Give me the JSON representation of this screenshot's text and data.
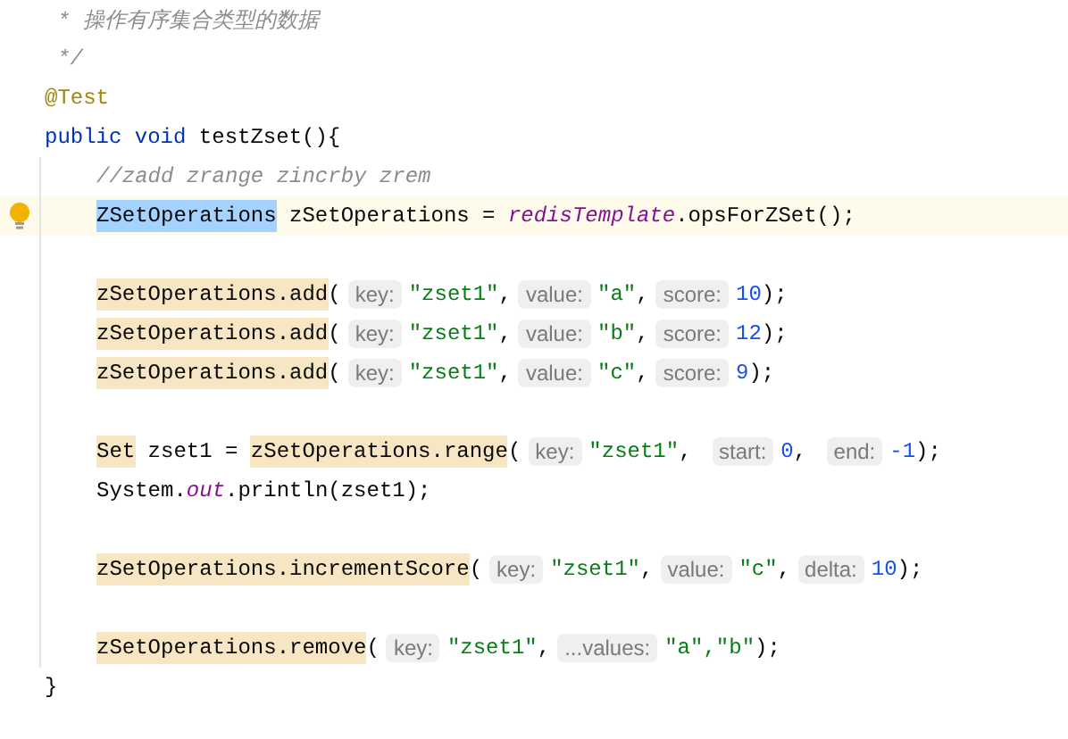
{
  "editor": {
    "lines": [
      {
        "kind": "doc",
        "tokens": [
          {
            "kind": "comment",
            "text": "* 操作有序集合类型的数据"
          }
        ]
      },
      {
        "kind": "doc",
        "tokens": [
          {
            "kind": "comment",
            "text": "*/"
          }
        ]
      },
      {
        "kind": "outer",
        "tokens": [
          {
            "kind": "annotation",
            "text": "@Test"
          }
        ]
      },
      {
        "kind": "outer",
        "tokens": [
          {
            "kind": "keyword",
            "text": "public void"
          },
          {
            "kind": "text",
            "text": " testZset(){"
          }
        ]
      },
      {
        "kind": "body",
        "tokens": [
          {
            "kind": "comment",
            "text": "//zadd zrange zincrby zrem"
          }
        ]
      },
      {
        "kind": "current",
        "tokens": [
          {
            "kind": "selection",
            "text": "ZSetOperations"
          },
          {
            "kind": "text",
            "text": " zSetOperations = "
          },
          {
            "kind": "field",
            "text": "redisTemplate"
          },
          {
            "kind": "text",
            "text": ".opsForZSet();"
          }
        ]
      },
      {
        "kind": "blank"
      },
      {
        "kind": "body",
        "tokens": [
          {
            "kind": "usage",
            "text": "zSetOperations.add"
          },
          {
            "kind": "text",
            "text": "("
          },
          {
            "kind": "hint",
            "text": "key:"
          },
          {
            "kind": "string",
            "text": "\"zset1\""
          },
          {
            "kind": "text",
            "text": ","
          },
          {
            "kind": "hint",
            "text": "value:"
          },
          {
            "kind": "string",
            "text": "\"a\""
          },
          {
            "kind": "text",
            "text": ","
          },
          {
            "kind": "hint",
            "text": "score:"
          },
          {
            "kind": "number",
            "text": "10"
          },
          {
            "kind": "text",
            "text": ");"
          }
        ]
      },
      {
        "kind": "body",
        "tokens": [
          {
            "kind": "usage",
            "text": "zSetOperations.add"
          },
          {
            "kind": "text",
            "text": "("
          },
          {
            "kind": "hint",
            "text": "key:"
          },
          {
            "kind": "string",
            "text": "\"zset1\""
          },
          {
            "kind": "text",
            "text": ","
          },
          {
            "kind": "hint",
            "text": "value:"
          },
          {
            "kind": "string",
            "text": "\"b\""
          },
          {
            "kind": "text",
            "text": ","
          },
          {
            "kind": "hint",
            "text": "score:"
          },
          {
            "kind": "number",
            "text": "12"
          },
          {
            "kind": "text",
            "text": ");"
          }
        ]
      },
      {
        "kind": "body",
        "tokens": [
          {
            "kind": "usage",
            "text": "zSetOperations.add"
          },
          {
            "kind": "text",
            "text": "("
          },
          {
            "kind": "hint",
            "text": "key:"
          },
          {
            "kind": "string",
            "text": "\"zset1\""
          },
          {
            "kind": "text",
            "text": ","
          },
          {
            "kind": "hint",
            "text": "value:"
          },
          {
            "kind": "string",
            "text": "\"c\""
          },
          {
            "kind": "text",
            "text": ","
          },
          {
            "kind": "hint",
            "text": "score:"
          },
          {
            "kind": "number",
            "text": "9"
          },
          {
            "kind": "text",
            "text": ");"
          }
        ]
      },
      {
        "kind": "blank"
      },
      {
        "kind": "body",
        "tokens": [
          {
            "kind": "usage",
            "text": "Set"
          },
          {
            "kind": "text",
            "text": " zset1 = "
          },
          {
            "kind": "usage",
            "text": "zSetOperations.range"
          },
          {
            "kind": "text",
            "text": "("
          },
          {
            "kind": "hint",
            "text": "key:"
          },
          {
            "kind": "string",
            "text": "\"zset1\""
          },
          {
            "kind": "text",
            "text": ", "
          },
          {
            "kind": "hint",
            "text": "start:"
          },
          {
            "kind": "number",
            "text": "0"
          },
          {
            "kind": "text",
            "text": ", "
          },
          {
            "kind": "hint",
            "text": "end:"
          },
          {
            "kind": "number",
            "text": "-1"
          },
          {
            "kind": "text",
            "text": ");"
          }
        ]
      },
      {
        "kind": "body",
        "tokens": [
          {
            "kind": "text",
            "text": "System."
          },
          {
            "kind": "field",
            "text": "out"
          },
          {
            "kind": "text",
            "text": ".println(zset1);"
          }
        ]
      },
      {
        "kind": "blank"
      },
      {
        "kind": "body",
        "tokens": [
          {
            "kind": "usage",
            "text": "zSetOperations.incrementScore"
          },
          {
            "kind": "text",
            "text": "("
          },
          {
            "kind": "hint",
            "text": "key:"
          },
          {
            "kind": "string",
            "text": "\"zset1\""
          },
          {
            "kind": "text",
            "text": ","
          },
          {
            "kind": "hint",
            "text": "value:"
          },
          {
            "kind": "string",
            "text": "\"c\""
          },
          {
            "kind": "text",
            "text": ","
          },
          {
            "kind": "hint",
            "text": "delta:"
          },
          {
            "kind": "number",
            "text": "10"
          },
          {
            "kind": "text",
            "text": ");"
          }
        ]
      },
      {
        "kind": "blank"
      },
      {
        "kind": "body",
        "tokens": [
          {
            "kind": "usage",
            "text": "zSetOperations.remove"
          },
          {
            "kind": "text",
            "text": "("
          },
          {
            "kind": "hint",
            "text": "key:"
          },
          {
            "kind": "string",
            "text": "\"zset1\""
          },
          {
            "kind": "text",
            "text": ","
          },
          {
            "kind": "hint",
            "text": "...values:"
          },
          {
            "kind": "string",
            "text": "\"a\",\"b\""
          },
          {
            "kind": "text",
            "text": ");"
          }
        ]
      },
      {
        "kind": "outer",
        "tokens": [
          {
            "kind": "text",
            "text": "}"
          }
        ]
      }
    ]
  }
}
